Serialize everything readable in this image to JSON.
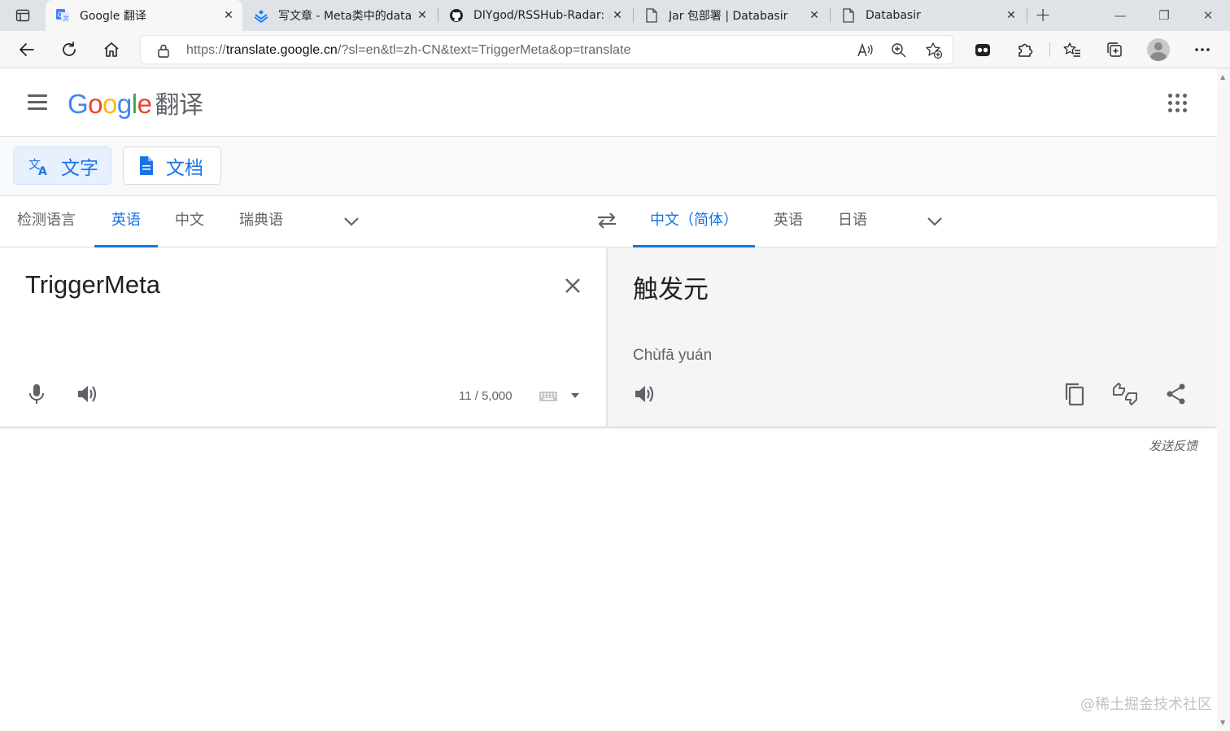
{
  "browser": {
    "tabs": [
      {
        "title": "Google 翻译",
        "favicon": "google-translate-icon",
        "active": true
      },
      {
        "title": "写文章 - Meta类中的data",
        "favicon": "juejin-icon",
        "active": false
      },
      {
        "title": "DIYgod/RSSHub-Radar: 🍰",
        "favicon": "github-icon",
        "active": false
      },
      {
        "title": "Jar 包部署 | Databasir",
        "favicon": "page-icon",
        "active": false
      },
      {
        "title": "Databasir",
        "favicon": "page-icon",
        "active": false
      }
    ],
    "tab_close": "✕",
    "new_tab": "+",
    "window_controls": {
      "minimize": "—",
      "restore": "❐",
      "close": "✕"
    },
    "url_prefix": "https://",
    "url_host": "translate.google.cn",
    "url_rest": "/?sl=en&tl=zh-CN&text=TriggerMeta&op=translate"
  },
  "header": {
    "logo_letters": [
      {
        "ch": "G",
        "color": "#4285F4"
      },
      {
        "ch": "o",
        "color": "#EA4335"
      },
      {
        "ch": "o",
        "color": "#FBBC05"
      },
      {
        "ch": "g",
        "color": "#4285F4"
      },
      {
        "ch": "l",
        "color": "#34A853"
      },
      {
        "ch": "e",
        "color": "#EA4335"
      }
    ],
    "product_name": "翻译"
  },
  "modes": {
    "text_label": "文字",
    "docs_label": "文档"
  },
  "source_langs": {
    "detect": "检测语言",
    "items": [
      "英语",
      "中文",
      "瑞典语"
    ],
    "selected": "英语"
  },
  "target_langs": {
    "items": [
      "中文（简体）",
      "英语",
      "日语"
    ],
    "selected": "中文（简体）"
  },
  "source": {
    "text": "TriggerMeta",
    "char_count": "11 / 5,000"
  },
  "target": {
    "text": "触发元",
    "romanization": "Chùfā yuán"
  },
  "footer": {
    "feedback": "发送反馈",
    "watermark": "@稀土掘金技术社区"
  },
  "colors": {
    "accent": "#1a73e8",
    "icon_gray": "#5f6368"
  }
}
